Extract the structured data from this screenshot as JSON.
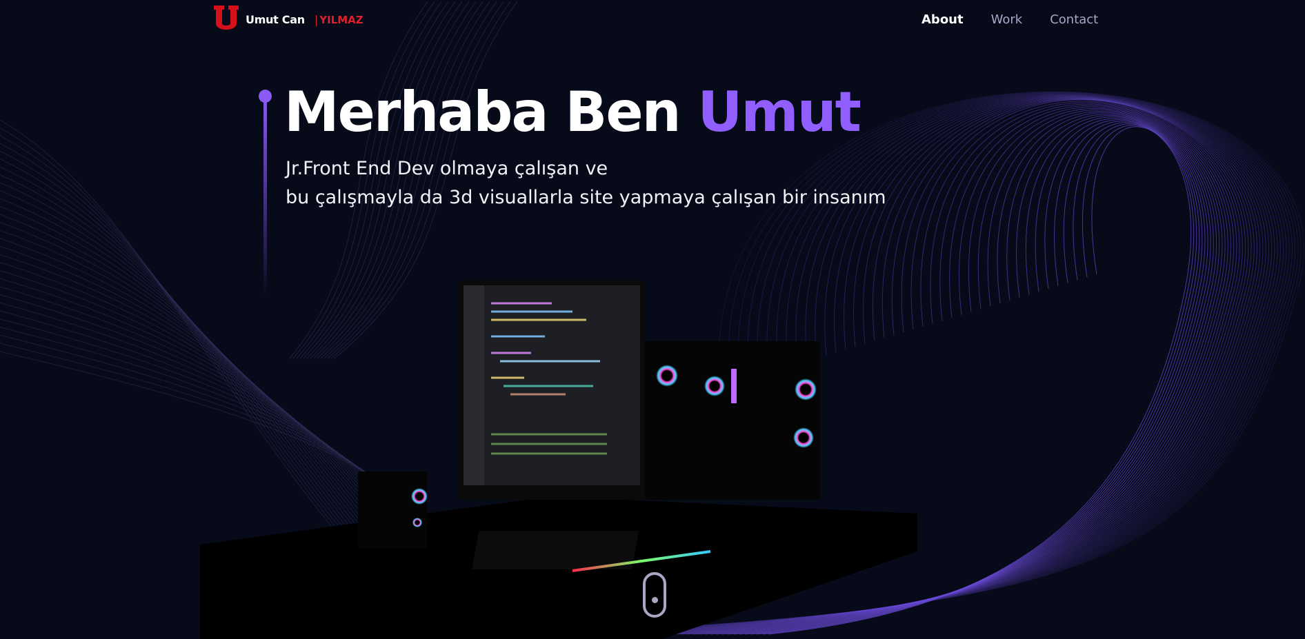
{
  "header": {
    "logo_letter": "U",
    "brand_first": "Umut Can",
    "brand_separator": "|",
    "brand_last": "YILMAZ",
    "nav": [
      {
        "label": "About",
        "active": true
      },
      {
        "label": "Work",
        "active": false
      },
      {
        "label": "Contact",
        "active": false
      }
    ]
  },
  "hero": {
    "title_prefix": "Merhaba Ben ",
    "title_highlight": "Umut",
    "subtitle_line1": "Jr.Front End Dev olmaya çalışan ve",
    "subtitle_line2": "bu çalışmayla da 3d visuallarla site yapmaya çalışan bir insanım"
  },
  "colors": {
    "accent": "#915eff",
    "brand_red": "#e0202a",
    "background": "#070a19"
  },
  "icons": {
    "scroll": "mouse-scroll-icon"
  }
}
